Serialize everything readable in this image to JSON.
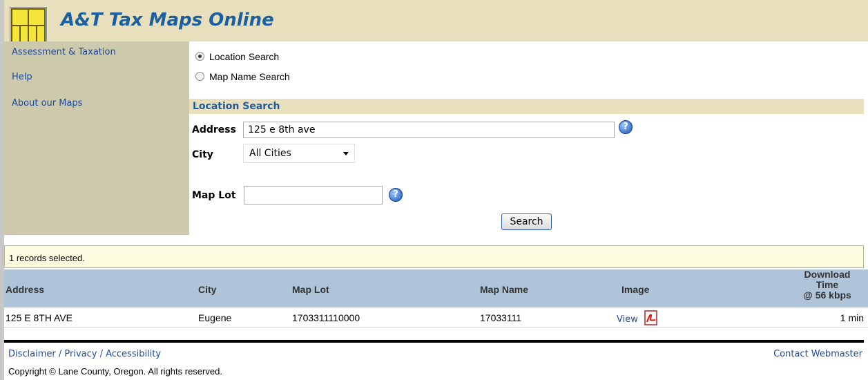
{
  "app": {
    "title": "A&T Tax Maps Online"
  },
  "sidebar": {
    "items": [
      {
        "label": "Assessment & Taxation"
      },
      {
        "label": "Help"
      },
      {
        "label": "About our Maps"
      }
    ]
  },
  "search_type": {
    "options": [
      {
        "label": "Location Search",
        "checked": true
      },
      {
        "label": "Map Name Search",
        "checked": false
      }
    ]
  },
  "location_search": {
    "section_title": "Location Search",
    "address_label": "Address",
    "address_value": "125 e 8th ave",
    "city_label": "City",
    "city_value": "All Cities",
    "maplot_label": "Map Lot",
    "maplot_value": "",
    "search_label": "Search"
  },
  "results": {
    "status": "1 records selected.",
    "headers": {
      "address": "Address",
      "city": "City",
      "map_lot": "Map Lot",
      "map_name": "Map Name",
      "image": "Image",
      "download_line1": "Download",
      "download_line2": "Time",
      "download_line3": "@ 56 kbps"
    },
    "rows": [
      {
        "address": "125 E 8TH AVE",
        "city": "Eugene",
        "map_lot": "1703311110000",
        "map_name": "17033111",
        "image_link": "View",
        "download_time": "1 min"
      }
    ]
  },
  "footer": {
    "links": "Disclaimer / Privacy / Accessibility",
    "copyright": "Copyright © Lane County, Oregon.  All rights reserved.",
    "contact": "Contact Webmaster"
  },
  "icons": {
    "help": "help-question-icon",
    "pdf": "pdf-icon",
    "logo": "map-grid-logo-icon",
    "dropdown": "chevron-down-icon"
  },
  "colors": {
    "header_bg": "#e8dfbd",
    "sidebar_bg": "#ccc9ad",
    "title_blue": "#1a5fa0",
    "table_header_bg": "#afc4d8",
    "records_bg": "#fdfde2"
  }
}
